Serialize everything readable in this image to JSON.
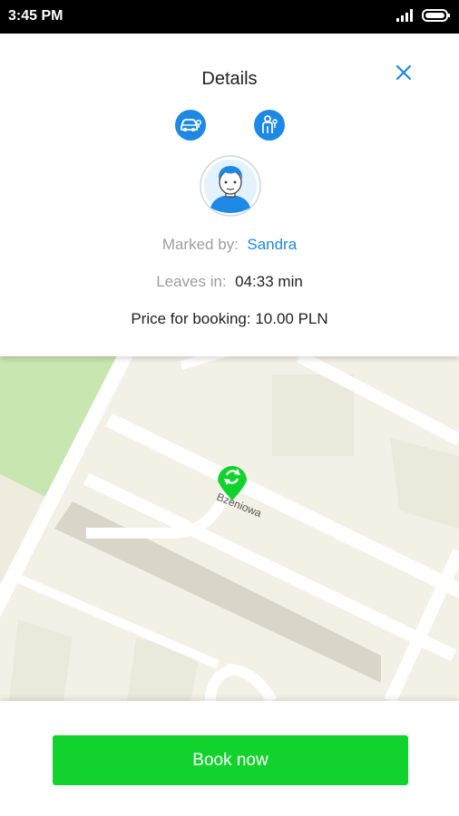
{
  "status_bar": {
    "time": "3:45 PM",
    "icons": [
      "signal-icon",
      "battery-icon"
    ]
  },
  "details": {
    "title": "Details",
    "close_icon": "close-icon",
    "service_icons": [
      "car-key-icon",
      "person-icon"
    ],
    "avatar_icon": "user-avatar",
    "marked_by_label": "Marked by:",
    "marked_by_value": "Sandra",
    "leaves_in_label": "Leaves in:",
    "leaves_in_value": "04:33 min",
    "price_text": "Price for booking: 10.00 PLN"
  },
  "map": {
    "street_label": "Bzeniowa",
    "marker_icon": "refresh-pin-icon"
  },
  "actions": {
    "book_label": "Book now"
  },
  "colors": {
    "accent_blue": "#1e88e5",
    "book_green": "#12d32e",
    "map_background": "#f3f1e6",
    "park_green": "#c8e6b0"
  }
}
